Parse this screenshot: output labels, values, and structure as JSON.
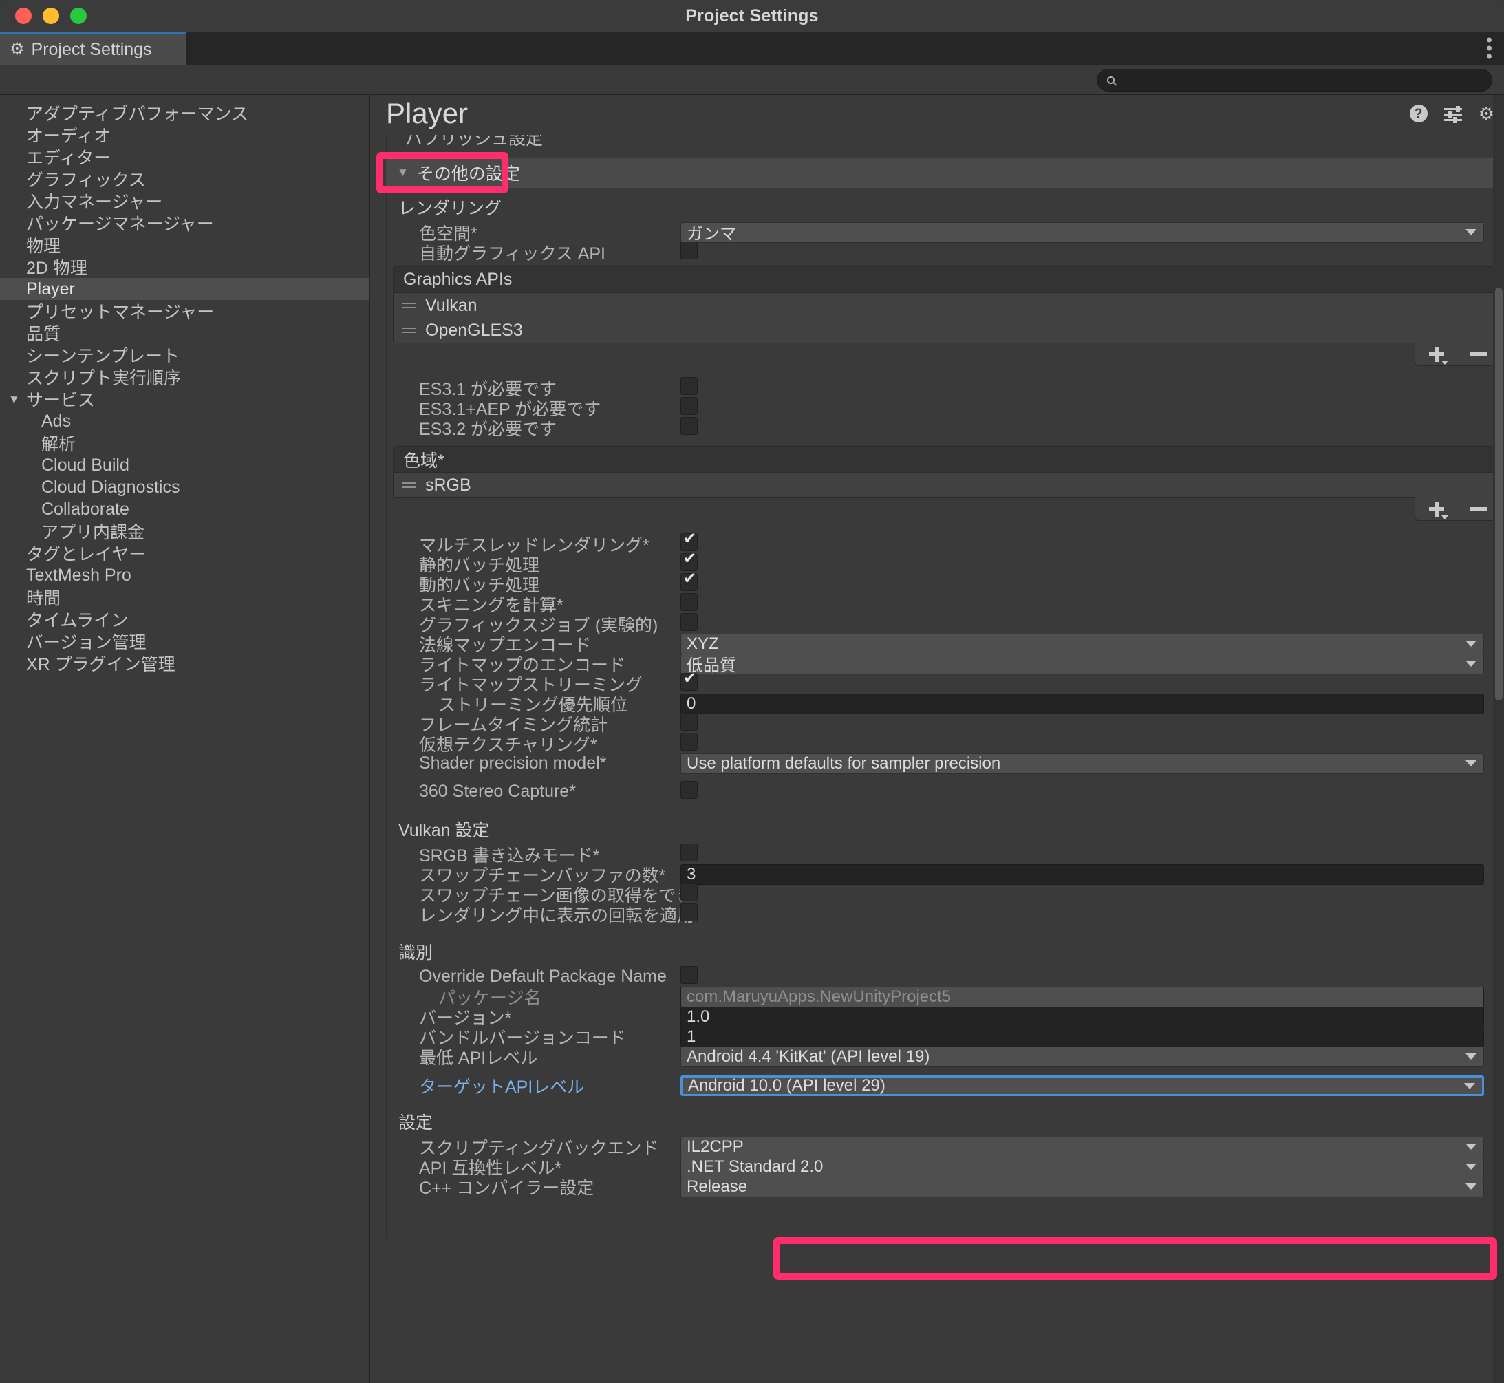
{
  "window": {
    "title": "Project Settings"
  },
  "tab": {
    "label": "Project Settings",
    "icon": "gear-icon",
    "overflow": "more-options"
  },
  "search": {
    "value": "",
    "placeholder": ""
  },
  "sidebar": {
    "items": [
      {
        "label": "アダプティブパフォーマンス",
        "selected": false,
        "child": false
      },
      {
        "label": "オーディオ",
        "selected": false,
        "child": false
      },
      {
        "label": "エディター",
        "selected": false,
        "child": false
      },
      {
        "label": "グラフィックス",
        "selected": false,
        "child": false
      },
      {
        "label": "入力マネージャー",
        "selected": false,
        "child": false
      },
      {
        "label": "パッケージマネージャー",
        "selected": false,
        "child": false
      },
      {
        "label": "物理",
        "selected": false,
        "child": false
      },
      {
        "label": "2D 物理",
        "selected": false,
        "child": false
      },
      {
        "label": "Player",
        "selected": true,
        "child": false
      },
      {
        "label": "プリセットマネージャー",
        "selected": false,
        "child": false
      },
      {
        "label": "品質",
        "selected": false,
        "child": false
      },
      {
        "label": "シーンテンプレート",
        "selected": false,
        "child": false
      },
      {
        "label": "スクリプト実行順序",
        "selected": false,
        "child": false
      },
      {
        "label": "サービス",
        "selected": false,
        "child": false,
        "caret": "▼"
      },
      {
        "label": "Ads",
        "selected": false,
        "child": true
      },
      {
        "label": "解析",
        "selected": false,
        "child": true
      },
      {
        "label": "Cloud Build",
        "selected": false,
        "child": true
      },
      {
        "label": "Cloud Diagnostics",
        "selected": false,
        "child": true
      },
      {
        "label": "Collaborate",
        "selected": false,
        "child": true
      },
      {
        "label": "アプリ内課金",
        "selected": false,
        "child": true
      },
      {
        "label": "タグとレイヤー",
        "selected": false,
        "child": false
      },
      {
        "label": "TextMesh Pro",
        "selected": false,
        "child": false
      },
      {
        "label": "時間",
        "selected": false,
        "child": false
      },
      {
        "label": "タイムライン",
        "selected": false,
        "child": false
      },
      {
        "label": "バージョン管理",
        "selected": false,
        "child": false
      },
      {
        "label": "XR プラグイン管理",
        "selected": false,
        "child": false
      }
    ]
  },
  "panel": {
    "title": "Player",
    "icons": {
      "help": "?",
      "preset": "preset-icon",
      "settings": "gear-icon"
    }
  },
  "content": {
    "clipped_top_label": "パブリッシュ設定",
    "foldout": {
      "label": "その他の設定",
      "triangle": "▼",
      "expanded": true
    },
    "rendering": {
      "heading": "レンダリング",
      "color_space_label": "色空間*",
      "color_space_value": "ガンマ",
      "auto_graphics_api_label": "自動グラフィックス API",
      "auto_graphics_api_checked": false,
      "graphics_apis_title": "Graphics APIs",
      "graphics_apis": [
        "Vulkan",
        "OpenGLES3"
      ],
      "requires": [
        {
          "label": "ES3.1 が必要です",
          "checked": false
        },
        {
          "label": "ES3.1+AEP が必要です",
          "checked": false
        },
        {
          "label": "ES3.2 が必要です",
          "checked": false
        }
      ],
      "color_gamut_title": "色域*",
      "color_gamuts": [
        "sRGB"
      ],
      "toggles": [
        {
          "label": "マルチスレッドレンダリング*",
          "checked": true
        },
        {
          "label": "静的バッチ処理",
          "checked": true
        },
        {
          "label": "動的バッチ処理",
          "checked": true
        },
        {
          "label": "スキニングを計算*",
          "checked": false
        },
        {
          "label": "グラフィックスジョブ (実験的)",
          "checked": false
        }
      ],
      "normal_map_label": "法線マップエンコード",
      "normal_map_value": "XYZ",
      "lightmap_enc_label": "ライトマップのエンコード",
      "lightmap_enc_value": "低品質",
      "lightmap_stream_label": "ライトマップストリーミング",
      "lightmap_stream_checked": true,
      "stream_priority_label": "ストリーミング優先順位",
      "stream_priority_value": "0",
      "frame_timing_label": "フレームタイミング統計",
      "frame_timing_checked": false,
      "virtual_tex_label": "仮想テクスチャリング*",
      "virtual_tex_checked": false,
      "shader_precision_label": "Shader precision model*",
      "shader_precision_value": "Use platform defaults for sampler precision",
      "stereo_capture_label": "360 Stereo Capture*",
      "stereo_capture_checked": false
    },
    "vulkan": {
      "heading": "Vulkan 設定",
      "srgb_write_label": "SRGB 書き込みモード*",
      "srgb_write_checked": false,
      "swapchain_buffers_label": "スワップチェーンバッファの数*",
      "swapchain_buffers_value": "3",
      "late_acquire_label": "スワップチェーン画像の取得をできる限り遅",
      "late_acquire_checked": false,
      "prerotation_label": "レンダリング中に表示の回転を適用",
      "prerotation_checked": false
    },
    "identification": {
      "heading": "識別",
      "override_pkg_label": "Override Default Package Name",
      "override_pkg_checked": false,
      "package_name_label": "パッケージ名",
      "package_name_value": "com.MaruyuApps.NewUnityProject5",
      "version_label": "バージョン*",
      "version_value": "1.0",
      "bundle_code_label": "バンドルバージョンコード",
      "bundle_code_value": "1",
      "min_api_label": "最低 APIレベル",
      "min_api_value": "Android 4.4 'KitKat' (API level 19)",
      "target_api_label": "ターゲットAPIレベル",
      "target_api_value": "Android 10.0 (API level 29)"
    },
    "configuration": {
      "heading": "設定",
      "scripting_backend_label": "スクリプティングバックエンド",
      "scripting_backend_value": "IL2CPP",
      "api_compat_label": "API 互換性レベル*",
      "api_compat_value": ".NET Standard 2.0",
      "cpp_compiler_label": "C++ コンパイラー設定",
      "cpp_compiler_value": "Release"
    }
  },
  "colors": {
    "highlight": "#ff2d6b",
    "accent_label": "#7cb0e8",
    "tab_accent": "#2f72b8",
    "focus_border": "#4a90d9"
  },
  "list_controls": {
    "add": "+",
    "remove": "−"
  }
}
